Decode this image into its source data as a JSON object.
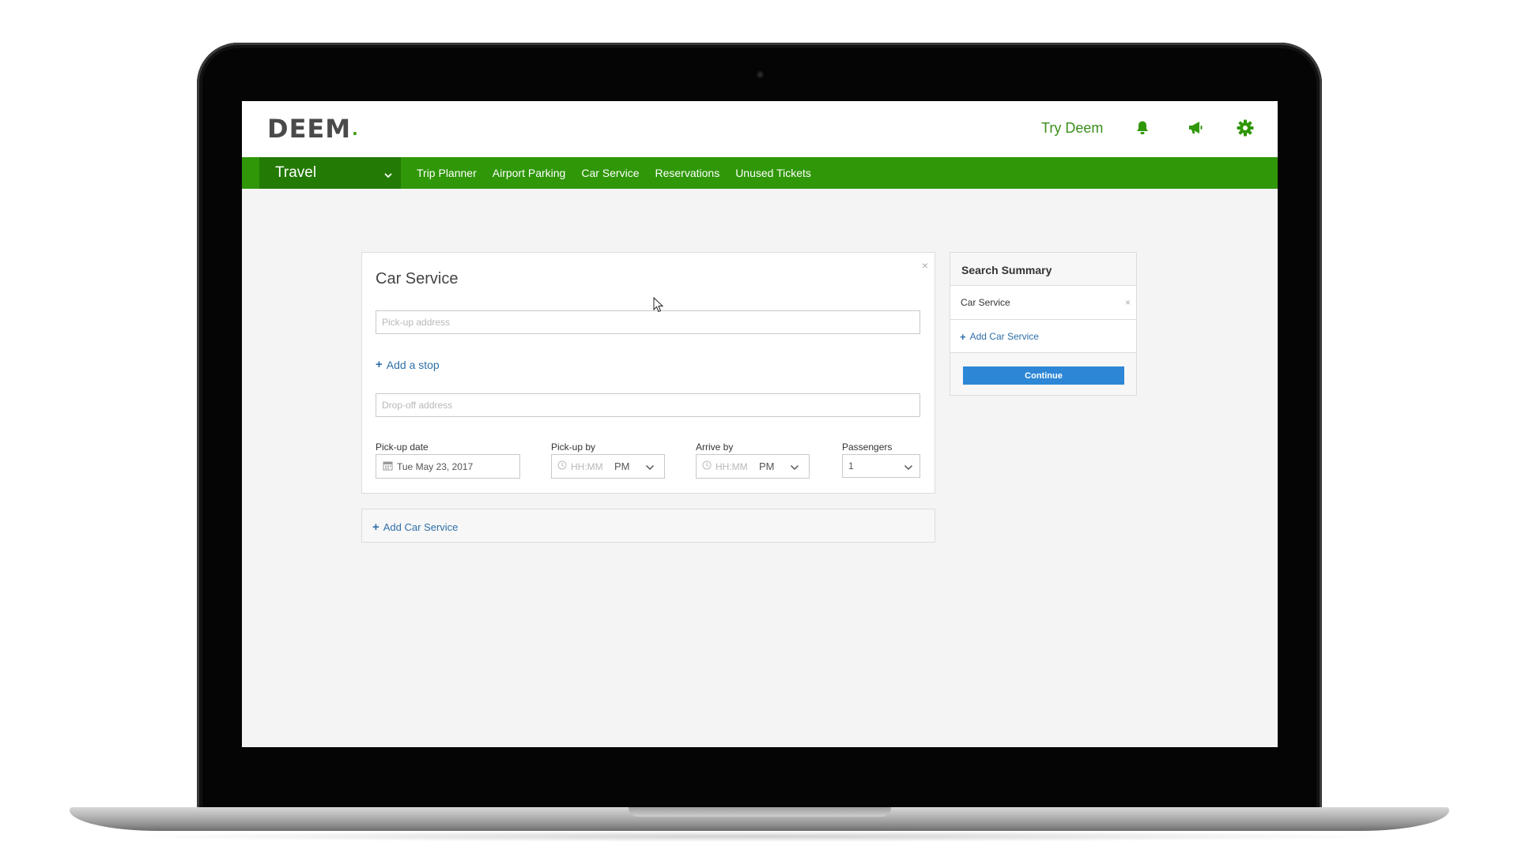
{
  "app": {
    "logo_text": "DEEM",
    "logo_dot": ".",
    "try_deem": "Try Deem",
    "icons": [
      "bell-icon",
      "megaphone-icon",
      "gear-icon"
    ],
    "brand_color": "#2f9708",
    "brand_dark": "#237a05",
    "link_color": "#2f6fa8",
    "button_color": "#2d87d6"
  },
  "nav": {
    "dropdown_label": "Travel",
    "links": [
      "Trip Planner",
      "Airport Parking",
      "Car Service",
      "Reservations",
      "Unused Tickets"
    ]
  },
  "car_service": {
    "title": "Car Service",
    "close": "×",
    "pickup_placeholder": "Pick-up address",
    "add_stop": "Add a stop",
    "dropoff_placeholder": "Drop-off address",
    "pickup_date_label": "Pick-up date",
    "pickup_date_value": "Tue May 23, 2017",
    "pickup_by_label": "Pick-up by",
    "pickup_by_placeholder": "HH:MM",
    "pickup_by_ampm": "PM",
    "arrive_by_label": "Arrive by",
    "arrive_by_placeholder": "HH:MM",
    "arrive_by_ampm": "PM",
    "passengers_label": "Passengers",
    "passengers_value": "1"
  },
  "add_car_service": {
    "label": "Add Car Service"
  },
  "summary": {
    "title": "Search Summary",
    "item": "Car Service",
    "item_remove": "×",
    "add_label": "Add Car Service",
    "continue_label": "Continue"
  }
}
